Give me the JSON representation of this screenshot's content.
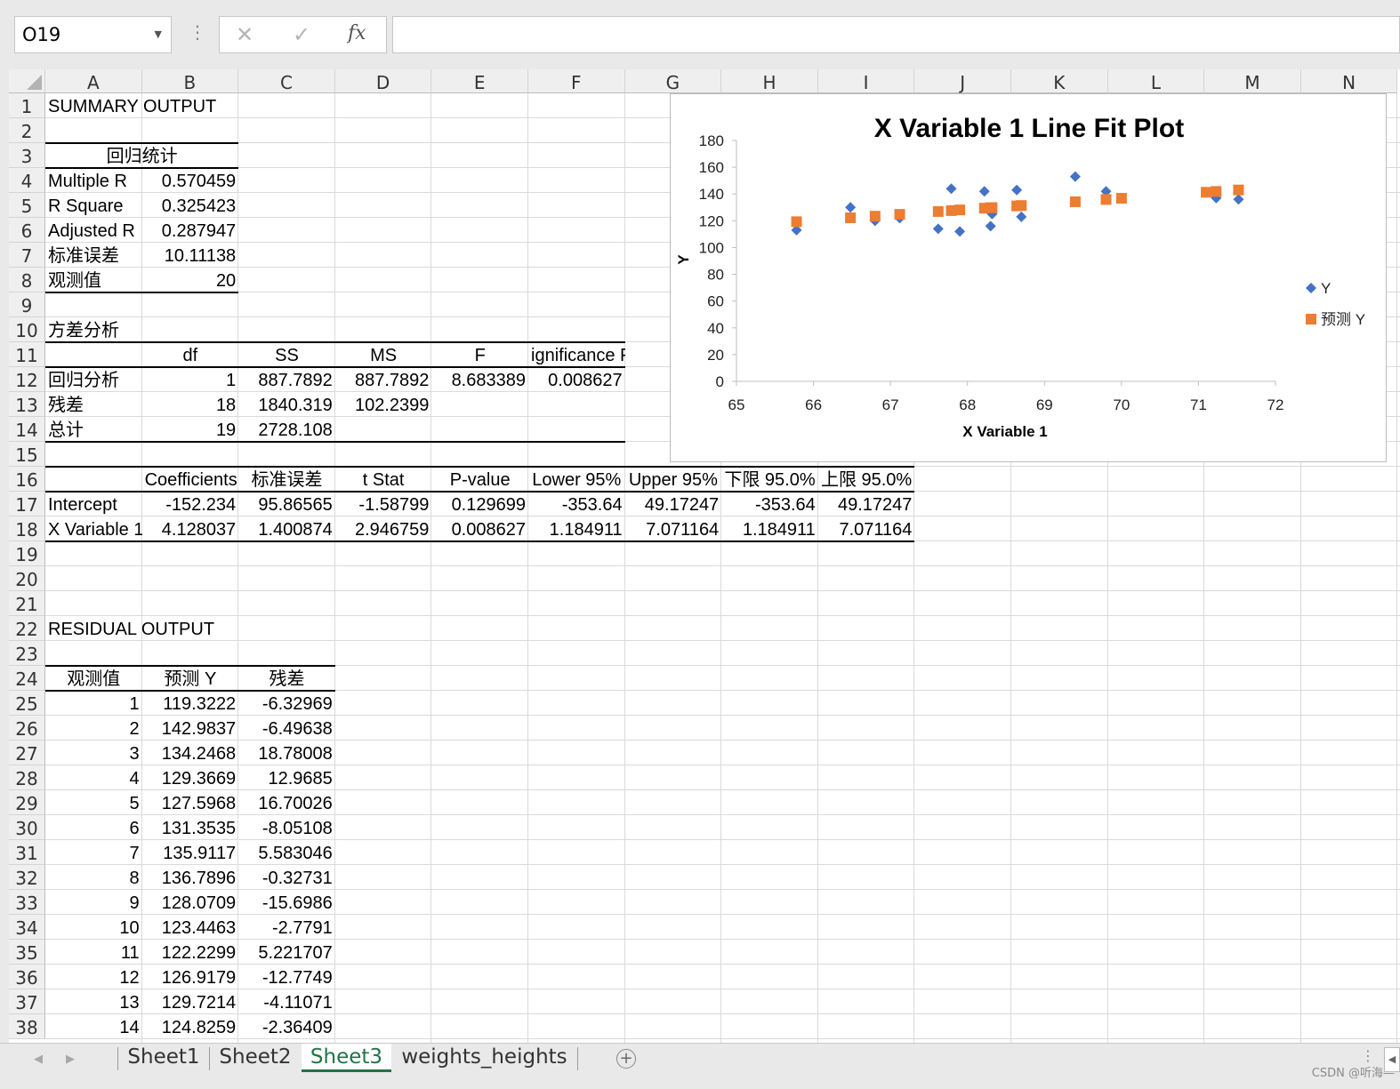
{
  "formula_bar": {
    "name_box": "O19",
    "cancel_glyph": "✕",
    "enter_glyph": "✓",
    "fx_label": "fx",
    "formula": ""
  },
  "columns": [
    "A",
    "B",
    "C",
    "D",
    "E",
    "F",
    "G",
    "H",
    "I",
    "J",
    "K",
    "L",
    "M",
    "N"
  ],
  "rows": [
    "1",
    "2",
    "3",
    "4",
    "5",
    "6",
    "7",
    "8",
    "9",
    "10",
    "11",
    "12",
    "13",
    "14",
    "15",
    "16",
    "17",
    "18",
    "19",
    "20",
    "21",
    "22",
    "23",
    "24",
    "25",
    "26",
    "27",
    "28",
    "29",
    "30",
    "31",
    "32",
    "33",
    "34",
    "35",
    "36",
    "37",
    "38"
  ],
  "summary": {
    "title": "SUMMARY OUTPUT",
    "stats_header": "回归统计",
    "stats": [
      {
        "label": "Multiple R",
        "value": "0.570459"
      },
      {
        "label": "R Square",
        "value": "0.325423"
      },
      {
        "label": "Adjusted R",
        "value": "0.287947"
      },
      {
        "label": "标准误差",
        "value": "10.11138"
      },
      {
        "label": "观测值",
        "value": "20"
      }
    ]
  },
  "anova": {
    "title": "方差分析",
    "headers": [
      "",
      "df",
      "SS",
      "MS",
      "F",
      "ignificance F"
    ],
    "rows": [
      [
        "回归分析",
        "1",
        "887.7892",
        "887.7892",
        "8.683389",
        "0.008627"
      ],
      [
        "残差",
        "18",
        "1840.319",
        "102.2399",
        "",
        ""
      ],
      [
        "总计",
        "19",
        "2728.108",
        "",
        "",
        ""
      ]
    ]
  },
  "coefficients": {
    "headers": [
      "",
      "Coefficients",
      "标准误差",
      "t Stat",
      "P-value",
      "Lower 95%",
      "Upper 95%",
      "下限 95.0%",
      "上限 95.0%"
    ],
    "rows": [
      [
        "Intercept",
        "-152.234",
        "95.86565",
        "-1.58799",
        "0.129699",
        "-353.64",
        "49.17247",
        "-353.64",
        "49.17247"
      ],
      [
        "X Variable 1",
        "4.128037",
        "1.400874",
        "2.946759",
        "0.008627",
        "1.184911",
        "7.071164",
        "1.184911",
        "7.071164"
      ]
    ]
  },
  "residual": {
    "title": "RESIDUAL OUTPUT",
    "headers": [
      "观测值",
      "预测 Y",
      "残差"
    ],
    "rows": [
      [
        "1",
        "119.3222",
        "-6.32969"
      ],
      [
        "2",
        "142.9837",
        "-6.49638"
      ],
      [
        "3",
        "134.2468",
        "18.78008"
      ],
      [
        "4",
        "129.3669",
        "12.9685"
      ],
      [
        "5",
        "127.5968",
        "16.70026"
      ],
      [
        "6",
        "131.3535",
        "-8.05108"
      ],
      [
        "7",
        "135.9117",
        "5.583046"
      ],
      [
        "8",
        "136.7896",
        "-0.32731"
      ],
      [
        "9",
        "128.0709",
        "-15.6986"
      ],
      [
        "10",
        "123.4463",
        "-2.7791"
      ],
      [
        "11",
        "122.2299",
        "5.221707"
      ],
      [
        "12",
        "126.9179",
        "-12.7749"
      ],
      [
        "13",
        "129.7214",
        "-4.11071"
      ],
      [
        "14",
        "124.8259",
        "-2.36409"
      ]
    ]
  },
  "chart_data": {
    "type": "scatter",
    "title": "X Variable 1 Line Fit  Plot",
    "xlabel": "X Variable 1",
    "ylabel": "Y",
    "xlim": [
      65,
      72
    ],
    "ylim": [
      0,
      180
    ],
    "xticks": [
      65,
      66,
      67,
      68,
      69,
      70,
      71,
      72
    ],
    "yticks": [
      0,
      20,
      40,
      60,
      80,
      100,
      120,
      140,
      160,
      180
    ],
    "legend_position": "right",
    "series": [
      {
        "name": "Y",
        "marker": "diamond",
        "color": "#4472C4",
        "points": [
          [
            65.78,
            113
          ],
          [
            66.48,
            130
          ],
          [
            66.8,
            120
          ],
          [
            67.12,
            122
          ],
          [
            67.62,
            114
          ],
          [
            67.79,
            144
          ],
          [
            67.9,
            112
          ],
          [
            68.22,
            142
          ],
          [
            68.3,
            116
          ],
          [
            68.32,
            125
          ],
          [
            68.64,
            143
          ],
          [
            68.7,
            123
          ],
          [
            69.4,
            153
          ],
          [
            69.8,
            142
          ],
          [
            70.0,
            137
          ],
          [
            71.1,
            141
          ],
          [
            71.23,
            137
          ],
          [
            71.52,
            136
          ]
        ]
      },
      {
        "name": "预测 Y",
        "marker": "square",
        "color": "#ED7D31",
        "points": [
          [
            65.78,
            119.3
          ],
          [
            66.48,
            122.2
          ],
          [
            66.8,
            123.4
          ],
          [
            67.12,
            124.8
          ],
          [
            67.62,
            126.9
          ],
          [
            67.79,
            127.6
          ],
          [
            67.9,
            128.1
          ],
          [
            68.22,
            129.4
          ],
          [
            68.3,
            129.7
          ],
          [
            68.32,
            129.8
          ],
          [
            68.64,
            131.1
          ],
          [
            68.7,
            131.4
          ],
          [
            69.4,
            134.2
          ],
          [
            69.8,
            135.9
          ],
          [
            70.0,
            136.8
          ],
          [
            71.1,
            141.3
          ],
          [
            71.23,
            141.9
          ],
          [
            71.52,
            143.0
          ]
        ]
      }
    ]
  },
  "sheet_tabs": {
    "tabs": [
      "Sheet1",
      "Sheet2",
      "Sheet3",
      "weights_heights"
    ],
    "active": "Sheet3",
    "add_glyph": "+",
    "watermark": "CSDN @听海—"
  }
}
